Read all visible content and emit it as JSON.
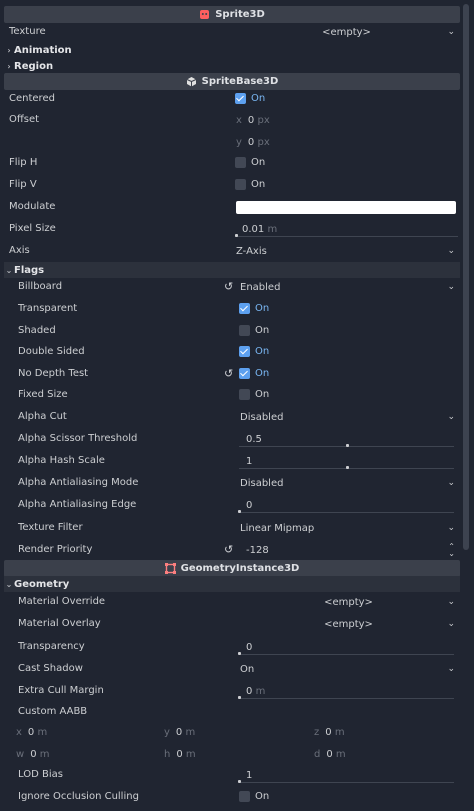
{
  "colors": {
    "bg": "#202531",
    "header": "#3b404b",
    "field": "#1a1e27",
    "accent": "#5da0ef",
    "modulate": "#ffffff"
  },
  "sprite3d": {
    "title": "Sprite3D",
    "icon": "sprite3d-icon",
    "texture": {
      "label": "Texture",
      "value": "<empty>"
    },
    "animation": "Animation",
    "region": "Region"
  },
  "spritebase3d": {
    "title": "SpriteBase3D",
    "icon": "spritebase3d-icon",
    "centered": {
      "label": "Centered",
      "value": "On",
      "checked": true
    },
    "offset": {
      "label": "Offset",
      "x_label": "x",
      "x_value": "0",
      "y_label": "y",
      "y_value": "0",
      "unit": "px"
    },
    "flip_h": {
      "label": "Flip H",
      "value": "On",
      "checked": false
    },
    "flip_v": {
      "label": "Flip V",
      "value": "On",
      "checked": false
    },
    "modulate": {
      "label": "Modulate"
    },
    "pixel_size": {
      "label": "Pixel Size",
      "value": "0.01",
      "unit": "m"
    },
    "axis": {
      "label": "Axis",
      "value": "Z-Axis"
    }
  },
  "flags": {
    "title": "Flags",
    "billboard": {
      "label": "Billboard",
      "value": "Enabled"
    },
    "transparent": {
      "label": "Transparent",
      "value": "On",
      "checked": true
    },
    "shaded": {
      "label": "Shaded",
      "value": "On",
      "checked": false
    },
    "double_sided": {
      "label": "Double Sided",
      "value": "On",
      "checked": true
    },
    "no_depth_test": {
      "label": "No Depth Test",
      "value": "On",
      "checked": true
    },
    "fixed_size": {
      "label": "Fixed Size",
      "value": "On",
      "checked": false
    },
    "alpha_cut": {
      "label": "Alpha Cut",
      "value": "Disabled"
    },
    "alpha_scissor": {
      "label": "Alpha Scissor Threshold",
      "value": "0.5",
      "fraction": 0.5
    },
    "alpha_hash": {
      "label": "Alpha Hash Scale",
      "value": "1",
      "fraction": 0.5
    },
    "aa_mode": {
      "label": "Alpha Antialiasing Mode",
      "value": "Disabled"
    },
    "aa_edge": {
      "label": "Alpha Antialiasing Edge",
      "value": "0",
      "fraction": 0
    },
    "texture_filter": {
      "label": "Texture Filter",
      "value": "Linear Mipmap"
    },
    "render_priority": {
      "label": "Render Priority",
      "value": "-128"
    }
  },
  "geometry_instance": {
    "title": "GeometryInstance3D",
    "icon": "geometry-instance-icon"
  },
  "geometry": {
    "title": "Geometry",
    "material_override": {
      "label": "Material Override",
      "value": "<empty>"
    },
    "material_overlay": {
      "label": "Material Overlay",
      "value": "<empty>"
    },
    "transparency": {
      "label": "Transparency",
      "value": "0",
      "fraction": 0
    },
    "cast_shadow": {
      "label": "Cast Shadow",
      "value": "On"
    },
    "extra_cull": {
      "label": "Extra Cull Margin",
      "value": "0",
      "unit": "m",
      "fraction": 0
    },
    "custom_aabb": {
      "label": "Custom AABB",
      "x": {
        "label": "x",
        "value": "0"
      },
      "y": {
        "label": "y",
        "value": "0"
      },
      "z": {
        "label": "z",
        "value": "0"
      },
      "w": {
        "label": "w",
        "value": "0"
      },
      "h": {
        "label": "h",
        "value": "0"
      },
      "d": {
        "label": "d",
        "value": "0"
      },
      "unit": "m"
    },
    "lod_bias": {
      "label": "LOD Bias",
      "value": "1",
      "fraction": 0
    },
    "ignore_occlusion": {
      "label": "Ignore Occlusion Culling",
      "value": "On",
      "checked": false
    }
  }
}
